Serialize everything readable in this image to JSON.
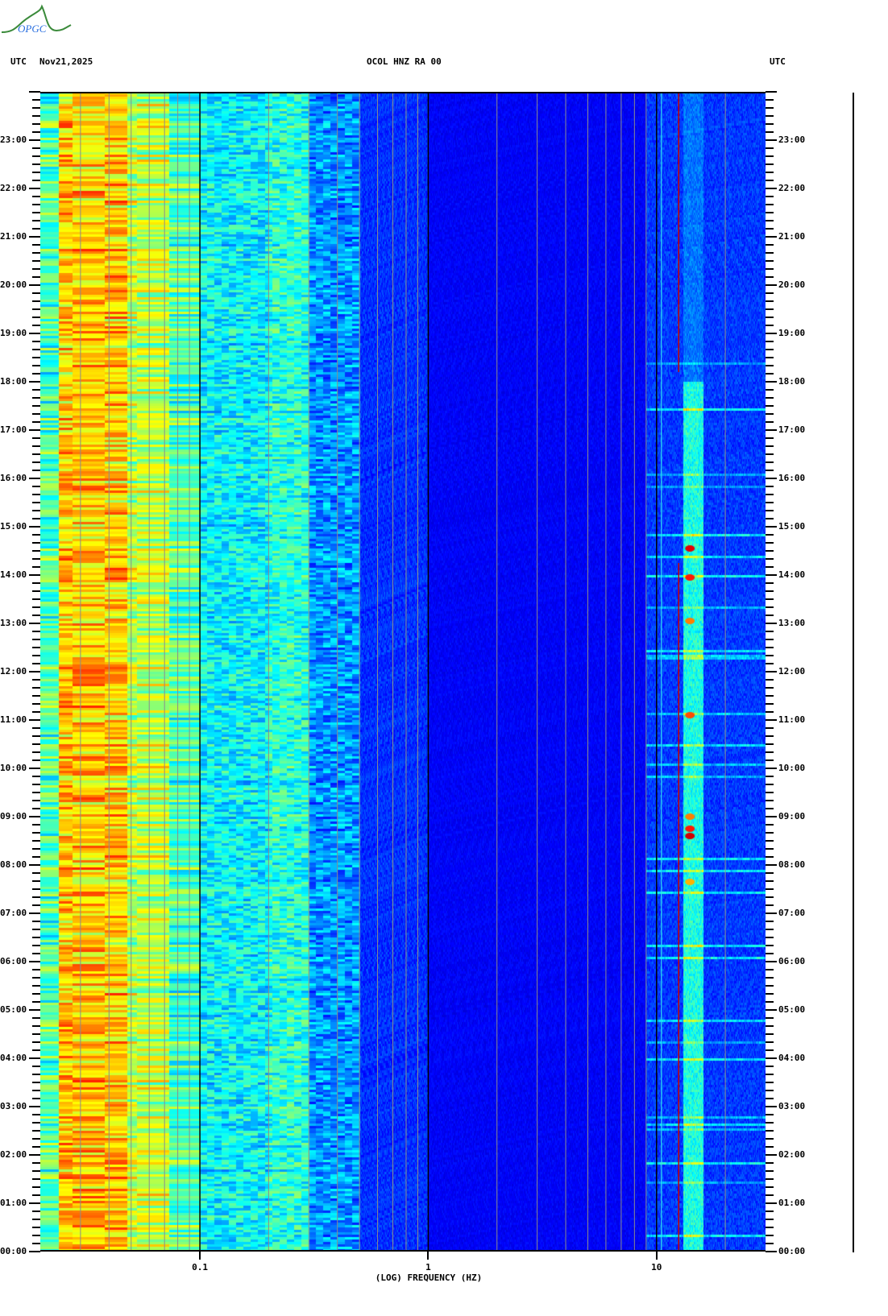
{
  "header": {
    "left_tz": "UTC",
    "date": "Nov21,2025",
    "station": "OCOL HNZ RA 00",
    "right_tz": "UTC",
    "logo_text": "OPGC"
  },
  "chart_data": {
    "type": "heatmap",
    "title": "OCOL HNZ RA 00",
    "xlabel": "(LOG) FREQUENCY (HZ)",
    "ylabel": "UTC",
    "x_scale": "log",
    "xlim": [
      0.02,
      30
    ],
    "ylim_hours": [
      0,
      24
    ],
    "x_ticks": [
      {
        "value": 0.1,
        "label": "0.1"
      },
      {
        "value": 1,
        "label": "1"
      },
      {
        "value": 10,
        "label": "10"
      }
    ],
    "y_ticks": [
      "00:00",
      "01:00",
      "02:00",
      "03:00",
      "04:00",
      "05:00",
      "06:00",
      "07:00",
      "08:00",
      "09:00",
      "10:00",
      "11:00",
      "12:00",
      "13:00",
      "14:00",
      "15:00",
      "16:00",
      "17:00",
      "18:00",
      "19:00",
      "20:00",
      "21:00",
      "22:00",
      "23:00"
    ],
    "y_minor_tick_minutes": 10,
    "colormap": "jet",
    "grid": "log-decade lines (black) and 2-9 multiples (gray)",
    "level_bands": [
      {
        "f_min": 0.02,
        "f_max": 0.024,
        "level": 0.45
      },
      {
        "f_min": 0.024,
        "f_max": 0.048,
        "level": 0.68
      },
      {
        "f_min": 0.048,
        "f_max": 0.073,
        "level": 0.56
      },
      {
        "f_min": 0.073,
        "f_max": 0.1,
        "level": 0.45
      },
      {
        "f_min": 0.1,
        "f_max": 0.2,
        "level": 0.37
      },
      {
        "f_min": 0.2,
        "f_max": 0.3,
        "level": 0.41
      },
      {
        "f_min": 0.3,
        "f_max": 0.5,
        "level": 0.27
      },
      {
        "f_min": 0.5,
        "f_max": 1,
        "level": 0.17
      },
      {
        "f_min": 1,
        "f_max": 9,
        "level": 0.12
      },
      {
        "f_min": 9,
        "f_max": 30,
        "level": 0.18
      }
    ],
    "persistent_lines": [
      {
        "freq": 10.5,
        "color": "cyan"
      },
      {
        "freq": 12.5,
        "color": "red",
        "hours": [
          [
            0,
            14.25
          ],
          [
            18.2,
            24
          ]
        ]
      }
    ],
    "noise_band": {
      "f_min": 13,
      "f_max": 16,
      "active_hours": [
        0,
        18
      ],
      "level": 0.4
    },
    "events": [
      {
        "hour": 14.55,
        "freq": 14,
        "level": 0.9
      },
      {
        "hour": 13.95,
        "freq": 14,
        "level": 0.85
      },
      {
        "hour": 13.05,
        "freq": 14,
        "level": 0.75
      },
      {
        "hour": 11.1,
        "freq": 14,
        "level": 0.8
      },
      {
        "hour": 8.6,
        "freq": 14,
        "level": 0.92
      },
      {
        "hour": 8.75,
        "freq": 14,
        "level": 0.85
      },
      {
        "hour": 9.0,
        "freq": 14,
        "level": 0.75
      },
      {
        "hour": 7.65,
        "freq": 14,
        "level": 0.7
      }
    ],
    "colors": {
      "grid_gray": "#8c8c8c",
      "decade_black": "#000000",
      "red_line": "#c80000"
    }
  }
}
